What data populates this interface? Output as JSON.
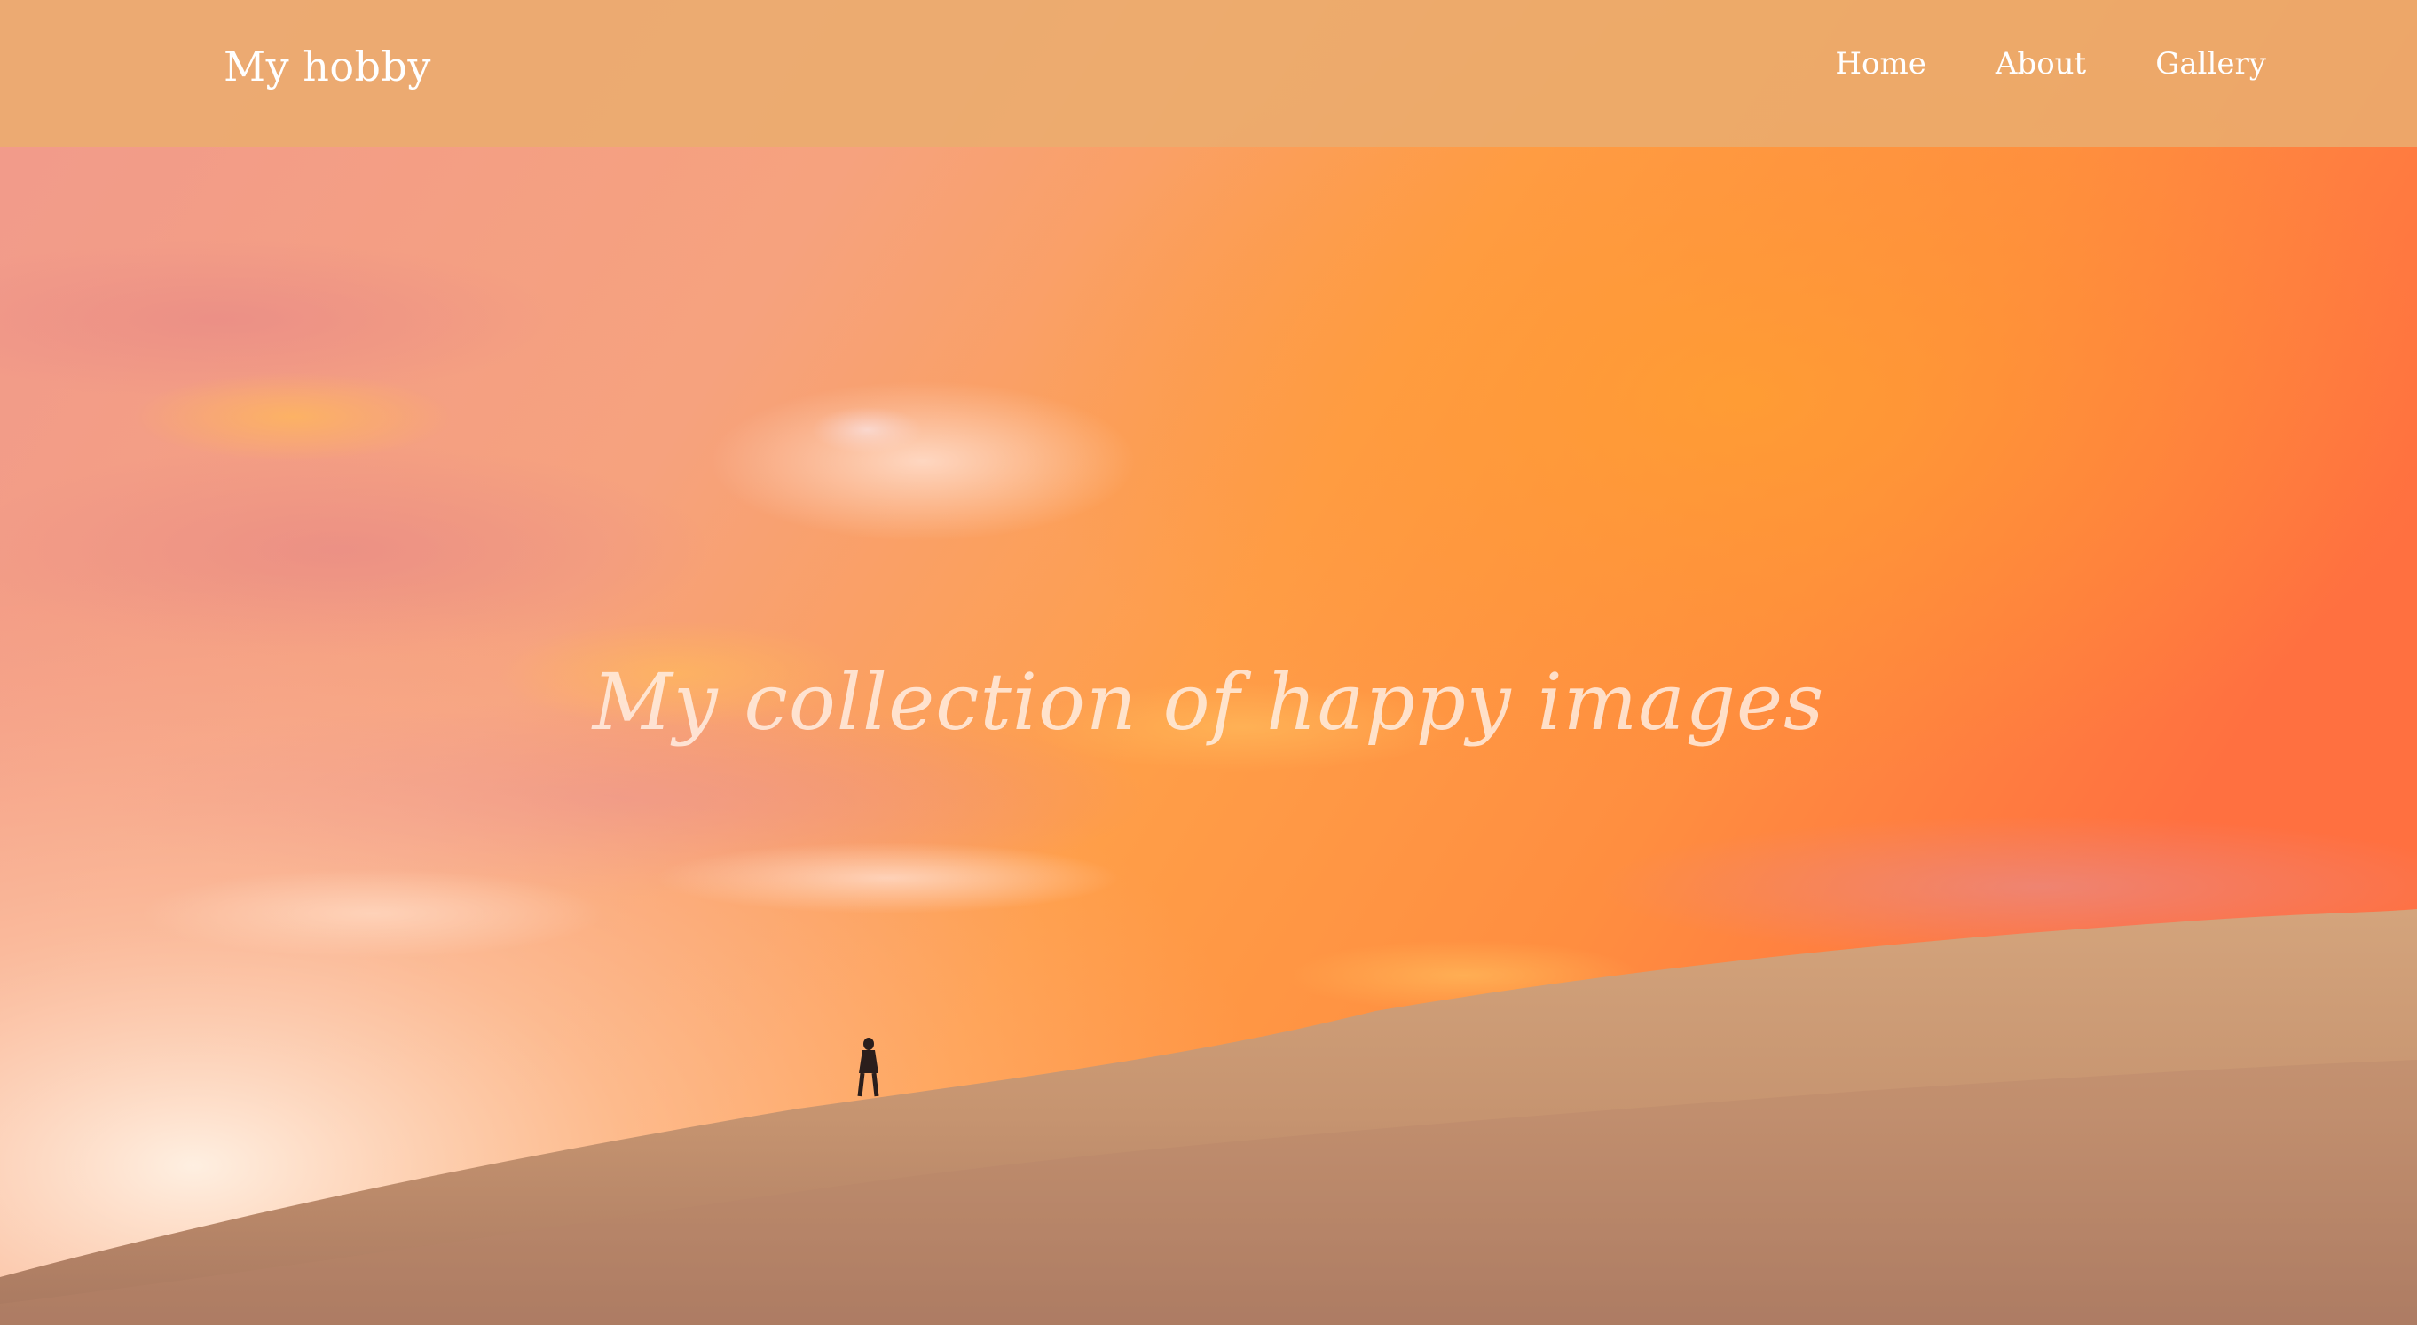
{
  "header": {
    "brand": "My hobby",
    "nav": [
      {
        "label": "Home"
      },
      {
        "label": "About"
      },
      {
        "label": "Gallery"
      }
    ]
  },
  "hero": {
    "headline": "My collection of happy images",
    "image_description": "sunset-desert-dune-with-lone-walker"
  },
  "colors": {
    "navbar": "#eaac6e",
    "sky_pink": "#f4a08a",
    "sky_orange": "#ff9a3c",
    "sand": "#c9936b",
    "text": "#ffffff"
  }
}
